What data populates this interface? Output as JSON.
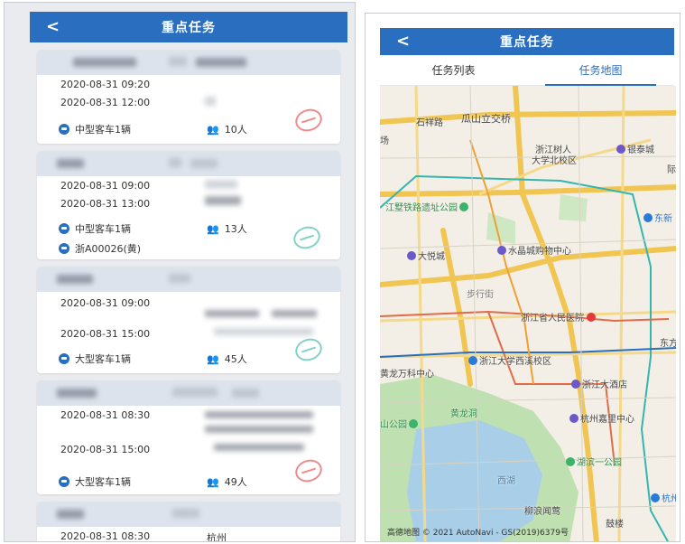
{
  "left": {
    "title": "重点任务",
    "back": "<",
    "cards": [
      {
        "dates": [
          "2020-08-31 09:20",
          "2020-08-31 12:00"
        ],
        "vehicle": "中型客车1辆",
        "people": "10人",
        "plate": "",
        "stamp": "red"
      },
      {
        "dates": [
          "2020-08-31 09:00",
          "2020-08-31 13:00"
        ],
        "vehicle": "中型客车1辆",
        "people": "13人",
        "plate": "浙A00026(黄)",
        "stamp": "teal"
      },
      {
        "dates": [
          "2020-08-31 09:00",
          "2020-08-31 15:00"
        ],
        "vehicle": "大型客车1辆",
        "people": "45人",
        "plate": "",
        "stamp": "teal"
      },
      {
        "dates": [
          "2020-08-31 08:30",
          "2020-08-31 15:00"
        ],
        "vehicle": "大型客车1辆",
        "people": "49人",
        "plate": "",
        "stamp": "red"
      },
      {
        "dates": [
          "2020-08-31 08:30"
        ],
        "vehicle": "",
        "people": "",
        "plate": "",
        "extra": "杭州"
      }
    ]
  },
  "right": {
    "title": "重点任务",
    "back": "<",
    "tabs": [
      {
        "label": "任务列表",
        "active": false
      },
      {
        "label": "任务地图",
        "active": true
      }
    ],
    "map_labels": {
      "l1": "石祥路",
      "l2": "瓜山立交桥",
      "l3": "浙江树人",
      "l3b": "大学北校区",
      "l4": "银泰城",
      "l5": "江墅铁路遗址公园",
      "l6": "东新",
      "l7": "水晶城购物中心",
      "l8": "大悦城",
      "l9": "步行街",
      "l10": "浙江省人民医院",
      "l11": "黄龙万科中心",
      "l12": "浙江大学西溪校区",
      "l13": "浙江大酒店",
      "l14": "东方",
      "l15": "黄龙洞",
      "l16": "山公园",
      "l17": "杭州嘉里中心",
      "l18": "湖滨一公园",
      "l19": "西湖",
      "l20": "柳浪闻莺",
      "l21": "鼓楼",
      "l22": "杭州站",
      "l23": "场",
      "l24": "际"
    },
    "copyright": "高德地图 © 2021 AutoNavi - GS(2019)6379号"
  }
}
